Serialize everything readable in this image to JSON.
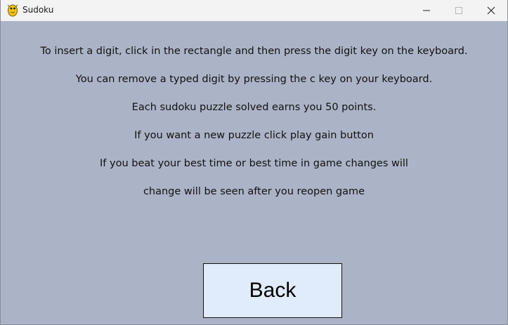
{
  "window": {
    "title": "Sudoku",
    "app_icon": "python-snake-icon"
  },
  "window_controls": {
    "minimize_icon": "minimize-icon",
    "maximize_icon": "maximize-icon",
    "close_icon": "close-icon"
  },
  "instructions": {
    "lines": [
      "To insert a digit, click in the rectangle and then press the digit key on the keyboard.",
      "You can remove a typed digit by pressing the c key on your keyboard.",
      "Each sudoku puzzle solved earns you 50 points.",
      "If you want a new puzzle click play gain button",
      "If you beat your best time or best time in game changes will",
      "change will be seen after you reopen game"
    ]
  },
  "back_button": {
    "label": "Back"
  },
  "colors": {
    "background": "#abb4c6",
    "button_fill": "#e0ebfb",
    "titlebar": "#f3f3f3"
  }
}
